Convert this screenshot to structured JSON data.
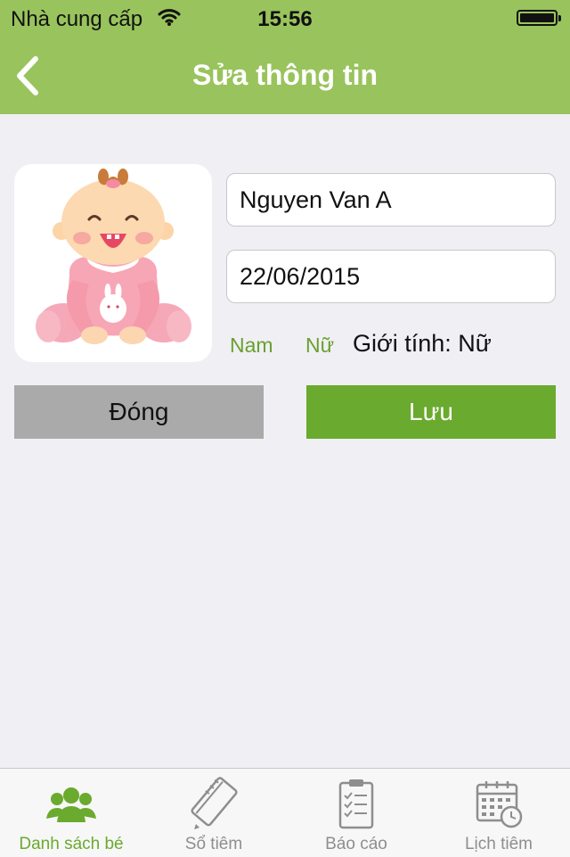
{
  "status_bar": {
    "carrier": "Nhà cung cấp",
    "time": "15:56"
  },
  "nav": {
    "title": "Sửa thông tin"
  },
  "form": {
    "name_value": "Nguyen Van A",
    "dob_value": "22/06/2015",
    "gender_option_male": "Nam",
    "gender_option_female": "Nữ",
    "gender_label": "Giới tính: Nữ"
  },
  "actions": {
    "close_label": "Đóng",
    "save_label": "Lưu"
  },
  "tabs": [
    {
      "label": "Danh sách bé",
      "icon": "people-icon",
      "active": true
    },
    {
      "label": "Sổ tiêm",
      "icon": "notebook-pen-icon",
      "active": false
    },
    {
      "label": "Báo cáo",
      "icon": "clipboard-checklist-icon",
      "active": false
    },
    {
      "label": "Lịch tiêm",
      "icon": "calendar-clock-icon",
      "active": false
    }
  ],
  "colors": {
    "header": "#99c35c",
    "accent": "#6aaa2e",
    "close_button": "#aaaaaa",
    "background": "#efeff4"
  }
}
